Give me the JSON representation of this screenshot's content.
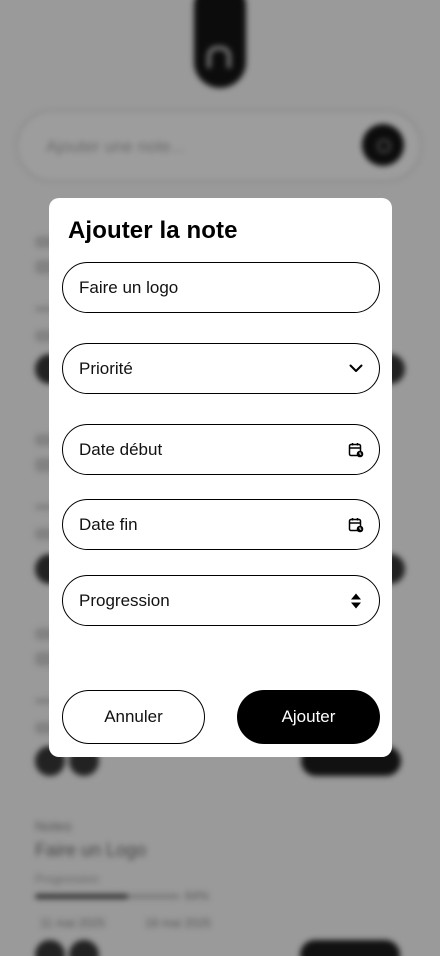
{
  "background": {
    "search_placeholder": "Ajouter une note...",
    "note": {
      "label": "Notes",
      "title": "Faire un Logo",
      "progress_label": "Progression",
      "progress_value": 0.64,
      "progress_text": "64%",
      "start_date": "11 mai 2025",
      "end_date": "18 mai 2025"
    }
  },
  "modal": {
    "title": "Ajouter la note",
    "note_input": {
      "value": "Faire un logo"
    },
    "priority_select": {
      "label": "Priorité",
      "icon": "chevron-down-icon"
    },
    "start_date_input": {
      "label": "Date début",
      "icon": "calendar-icon"
    },
    "end_date_input": {
      "label": "Date fin",
      "icon": "calendar-icon"
    },
    "progress_select": {
      "label": "Progression",
      "icon": "up-down-arrows-icon"
    },
    "cancel_label": "Annuler",
    "add_label": "Ajouter"
  },
  "colors": {
    "overlay": "#9a9a9a",
    "accent": "#000000",
    "surface": "#ffffff"
  }
}
